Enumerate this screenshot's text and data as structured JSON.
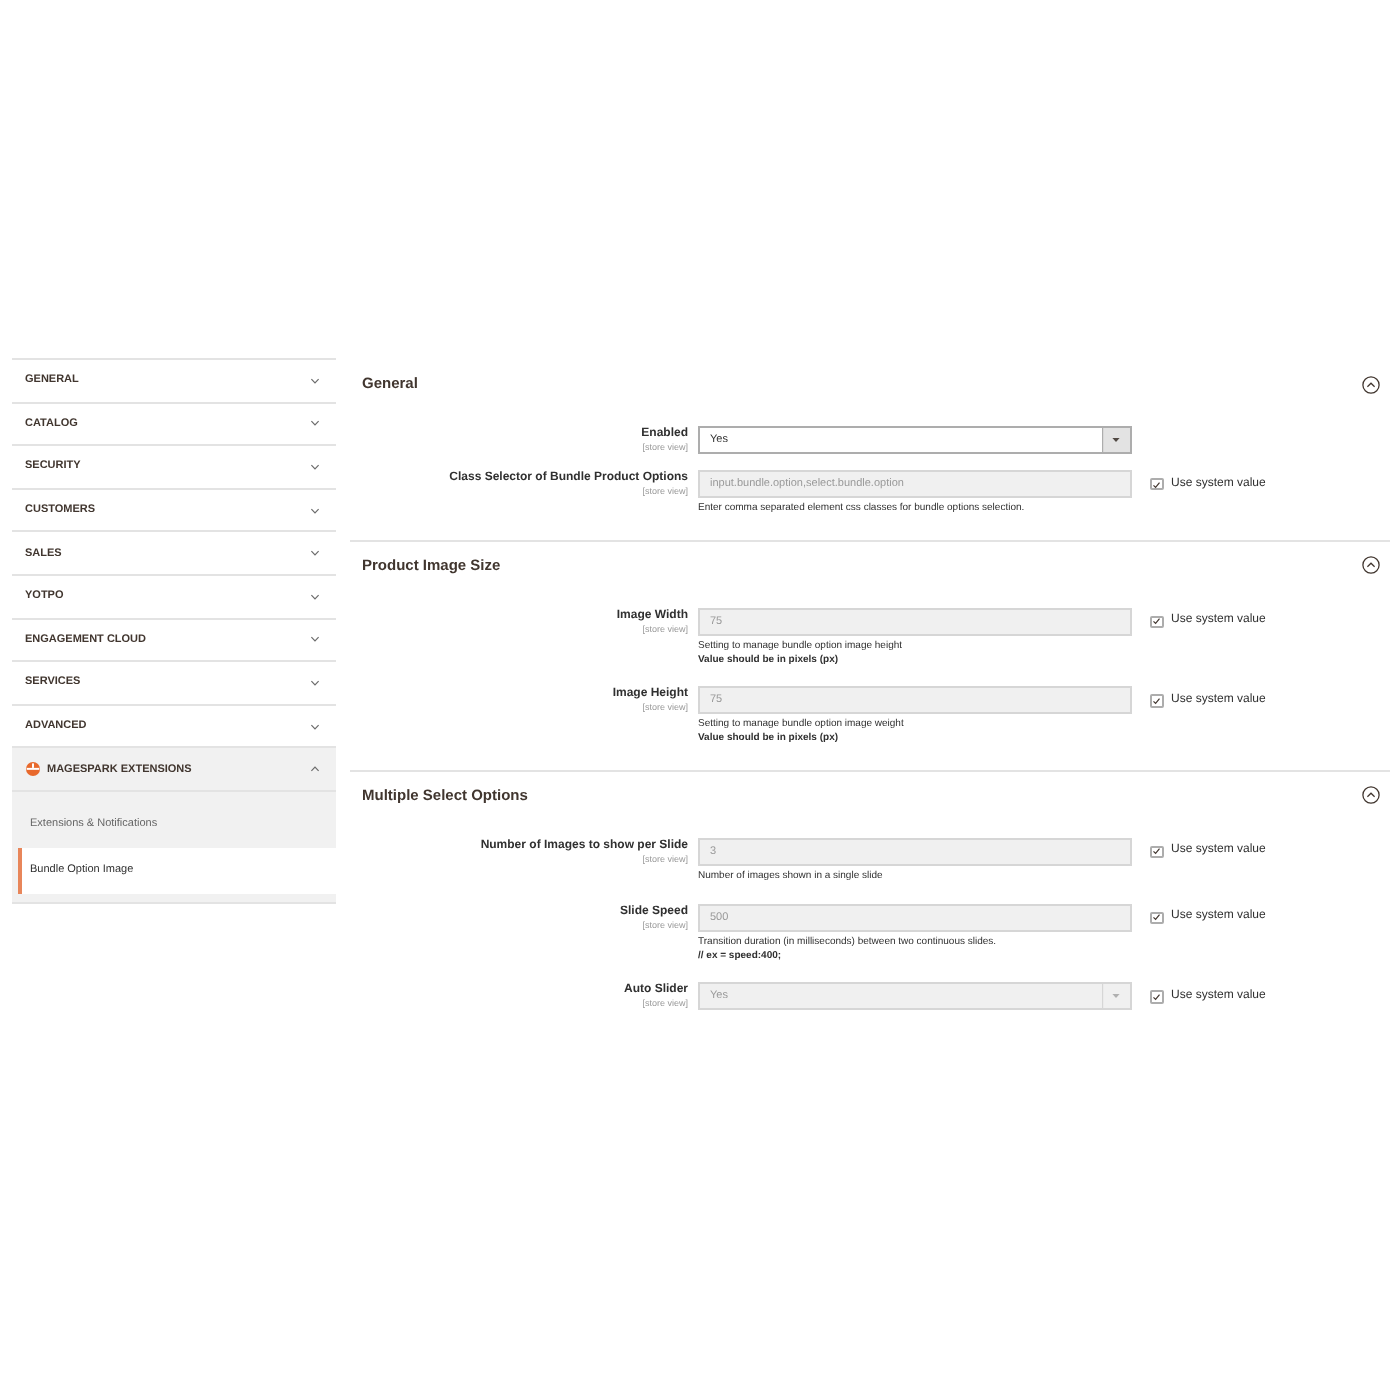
{
  "sidebar": {
    "items": [
      {
        "label": "GENERAL",
        "expanded": false
      },
      {
        "label": "CATALOG",
        "expanded": false
      },
      {
        "label": "SECURITY",
        "expanded": false
      },
      {
        "label": "CUSTOMERS",
        "expanded": false
      },
      {
        "label": "SALES",
        "expanded": false
      },
      {
        "label": "YOTPO",
        "expanded": false
      },
      {
        "label": "ENGAGEMENT CLOUD",
        "expanded": false
      },
      {
        "label": "SERVICES",
        "expanded": false
      },
      {
        "label": "ADVANCED",
        "expanded": false
      },
      {
        "label": "MAGESPARK EXTENSIONS",
        "expanded": true,
        "children": [
          {
            "label": "Extensions & Notifications",
            "selected": false
          },
          {
            "label": "Bundle Option Image",
            "selected": true
          }
        ]
      }
    ]
  },
  "sections": [
    {
      "title": "General",
      "expanded": true,
      "fields": [
        {
          "kind": "select",
          "label": "Enabled",
          "scope": "[store view]",
          "value": "Yes",
          "disabled": false
        },
        {
          "kind": "text",
          "label": "Class Selector of Bundle Product Options",
          "scope": "[store view]",
          "value": "input.bundle.option,select.bundle.option",
          "disabled": true,
          "note": [
            {
              "text": "Enter comma separated element css classes for bundle options selection.",
              "bold": false
            }
          ],
          "use_system_value": {
            "label": "Use system value",
            "checked": true
          }
        }
      ]
    },
    {
      "title": "Product Image Size",
      "expanded": true,
      "fields": [
        {
          "kind": "text",
          "label": "Image Width",
          "scope": "[store view]",
          "value": "75",
          "disabled": true,
          "note": [
            {
              "text": "Setting to manage bundle option image height",
              "bold": false
            },
            {
              "text": "Value should be in pixels (px)",
              "bold": true
            }
          ],
          "use_system_value": {
            "label": "Use system value",
            "checked": true
          }
        },
        {
          "kind": "text",
          "label": "Image Height",
          "scope": "[store view]",
          "value": "75",
          "disabled": true,
          "note": [
            {
              "text": "Setting to manage bundle option image weight",
              "bold": false
            },
            {
              "text": "Value should be in pixels (px)",
              "bold": true
            }
          ],
          "use_system_value": {
            "label": "Use system value",
            "checked": true
          }
        }
      ]
    },
    {
      "title": "Multiple Select Options",
      "expanded": true,
      "fields": [
        {
          "kind": "text",
          "label": "Number of Images to show per Slide",
          "scope": "[store view]",
          "value": "3",
          "disabled": true,
          "note": [
            {
              "text": "Number of images shown in a single slide",
              "bold": false
            }
          ],
          "use_system_value": {
            "label": "Use system value",
            "checked": true
          }
        },
        {
          "kind": "text",
          "label": "Slide Speed",
          "scope": "[store view]",
          "value": "500",
          "disabled": true,
          "note": [
            {
              "text": "Transition duration (in milliseconds) between two continuous slides.",
              "bold": false
            },
            {
              "text": "// ex = speed:400;",
              "bold": true
            }
          ],
          "use_system_value": {
            "label": "Use system value",
            "checked": true
          }
        },
        {
          "kind": "select",
          "label": "Auto Slider",
          "scope": "[store view]",
          "value": "Yes",
          "disabled": true,
          "use_system_value": {
            "label": "Use system value",
            "checked": true
          }
        }
      ]
    }
  ]
}
